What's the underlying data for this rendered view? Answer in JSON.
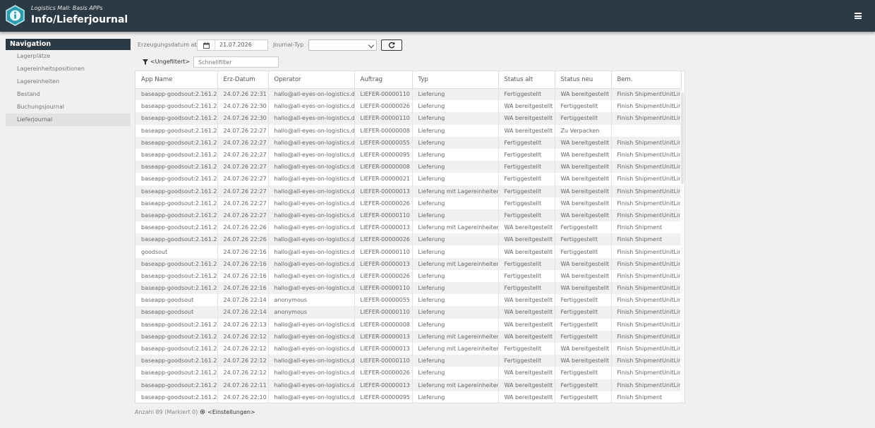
{
  "header": {
    "app_name": "Logistics Mall: Basis APPs",
    "page_title": "Info/Lieferjournal",
    "bg_color": "#2b3a45",
    "logo_color": "#2a9db0"
  },
  "nav": {
    "title": "Navigation",
    "items": [
      {
        "label": "Lagerplätze",
        "active": false
      },
      {
        "label": "Lagereinheitspositionen",
        "active": false
      },
      {
        "label": "Lagereinheiten",
        "active": false
      },
      {
        "label": "Bestand",
        "active": false
      },
      {
        "label": "Buchungsjournal",
        "active": false
      },
      {
        "label": "Lieferjournal",
        "active": true
      }
    ]
  },
  "filters": {
    "date_label": "Erzeugungsdatum ab",
    "date_value": "21.07.2026",
    "journal_type_label": "Journal-Typ",
    "journal_type_value": "",
    "unfiltered_label": "<Ungefiltert>",
    "quick_filter_placeholder": "Schnellfilter"
  },
  "table": {
    "columns": [
      "App Name",
      "Erz-Datum",
      "Operator",
      "Auftrag",
      "Typ",
      "Status alt",
      "Status neu",
      "Bem."
    ],
    "rows": [
      [
        "baseapp-goodsout:2.161.2",
        "24.07.26 22:31",
        "hallo@all-eyes-on-logistics.de",
        "LIEFER-00000110",
        "Lieferung",
        "Fertiggestellt",
        "WA bereitgestellt",
        "Finish ShipmentUnitLine"
      ],
      [
        "baseapp-goodsout:2.161.2",
        "24.07.26 22:30",
        "hallo@all-eyes-on-logistics.de",
        "LIEFER-00000026",
        "Lieferung",
        "WA bereitgestellt",
        "Fertiggestellt",
        "Finish ShipmentUnitLine"
      ],
      [
        "baseapp-goodsout:2.161.2",
        "24.07.26 22:30",
        "hallo@all-eyes-on-logistics.de",
        "LIEFER-00000110",
        "Lieferung",
        "WA bereitgestellt",
        "Fertiggestellt",
        "Finish ShipmentUnitLine"
      ],
      [
        "baseapp-goodsout:2.161.2",
        "24.07.26 22:27",
        "hallo@all-eyes-on-logistics.de",
        "LIEFER-00000008",
        "Lieferung",
        "WA bereitgestellt",
        "Zu Verpacken",
        ""
      ],
      [
        "baseapp-goodsout:2.161.2",
        "24.07.26 22:27",
        "hallo@all-eyes-on-logistics.de",
        "LIEFER-00000055",
        "Lieferung",
        "Fertiggestellt",
        "WA bereitgestellt",
        "Finish ShipmentUnitLine"
      ],
      [
        "baseapp-goodsout:2.161.2",
        "24.07.26 22:27",
        "hallo@all-eyes-on-logistics.de",
        "LIEFER-00000095",
        "Lieferung",
        "Fertiggestellt",
        "WA bereitgestellt",
        "Finish ShipmentUnitLine"
      ],
      [
        "baseapp-goodsout:2.161.2",
        "24.07.26 22:27",
        "hallo@all-eyes-on-logistics.de",
        "LIEFER-00000008",
        "Lieferung",
        "Fertiggestellt",
        "WA bereitgestellt",
        "Finish ShipmentUnitLine"
      ],
      [
        "baseapp-goodsout:2.161.2",
        "24.07.26 22:27",
        "hallo@all-eyes-on-logistics.de",
        "LIEFER-00000021",
        "Lieferung",
        "Fertiggestellt",
        "WA bereitgestellt",
        "Finish ShipmentUnitLine"
      ],
      [
        "baseapp-goodsout:2.161.2",
        "24.07.26 22:27",
        "hallo@all-eyes-on-logistics.de",
        "LIEFER-00000013",
        "Lieferung mit Lagereinheiten",
        "Fertiggestellt",
        "WA bereitgestellt",
        "Finish ShipmentUnitLine"
      ],
      [
        "baseapp-goodsout:2.161.2",
        "24.07.26 22:27",
        "hallo@all-eyes-on-logistics.de",
        "LIEFER-00000026",
        "Lieferung",
        "Fertiggestellt",
        "WA bereitgestellt",
        "Finish ShipmentUnitLine"
      ],
      [
        "baseapp-goodsout:2.161.2",
        "24.07.26 22:27",
        "hallo@all-eyes-on-logistics.de",
        "LIEFER-00000110",
        "Lieferung",
        "Fertiggestellt",
        "WA bereitgestellt",
        "Finish ShipmentUnitLine"
      ],
      [
        "baseapp-goodsout:2.161.2",
        "24.07.26 22:26",
        "hallo@all-eyes-on-logistics.de",
        "LIEFER-00000013",
        "Lieferung mit Lagereinheiten",
        "WA bereitgestellt",
        "Fertiggestellt",
        "Finish Shipment"
      ],
      [
        "baseapp-goodsout:2.161.2",
        "24.07.26 22:26",
        "hallo@all-eyes-on-logistics.de",
        "LIEFER-00000026",
        "Lieferung",
        "WA bereitgestellt",
        "Fertiggestellt",
        "Finish Shipment"
      ],
      [
        "goodsout",
        "24.07.26 22:16",
        "hallo@all-eyes-on-logistics.de",
        "LIEFER-00000110",
        "Lieferung",
        "WA bereitgestellt",
        "Fertiggestellt",
        "Finish ShipmentUnitLine"
      ],
      [
        "baseapp-goodsout:2.161.2",
        "24.07.26 22:16",
        "hallo@all-eyes-on-logistics.de",
        "LIEFER-00000013",
        "Lieferung mit Lagereinheiten",
        "Fertiggestellt",
        "WA bereitgestellt",
        "Finish ShipmentUnitLine"
      ],
      [
        "baseapp-goodsout:2.161.2",
        "24.07.26 22:16",
        "hallo@all-eyes-on-logistics.de",
        "LIEFER-00000026",
        "Lieferung",
        "Fertiggestellt",
        "WA bereitgestellt",
        "Finish ShipmentUnitLine"
      ],
      [
        "baseapp-goodsout:2.161.2",
        "24.07.26 22:16",
        "hallo@all-eyes-on-logistics.de",
        "LIEFER-00000110",
        "Lieferung",
        "Fertiggestellt",
        "WA bereitgestellt",
        "Finish ShipmentUnitLine"
      ],
      [
        "baseapp-goodsout",
        "24.07.26 22:14",
        "anonymous",
        "LIEFER-00000055",
        "Lieferung",
        "WA bereitgestellt",
        "Fertiggestellt",
        "Finish ShipmentUnitLine"
      ],
      [
        "baseapp-goodsout",
        "24.07.26 22:14",
        "anonymous",
        "LIEFER-00000110",
        "Lieferung",
        "WA bereitgestellt",
        "Fertiggestellt",
        "Finish ShipmentUnitLine"
      ],
      [
        "baseapp-goodsout:2.161.2",
        "24.07.26 22:13",
        "hallo@all-eyes-on-logistics.de",
        "LIEFER-00000008",
        "Lieferung",
        "WA bereitgestellt",
        "Fertiggestellt",
        "Finish ShipmentUnitLine"
      ],
      [
        "baseapp-goodsout:2.161.2",
        "24.07.26 22:12",
        "hallo@all-eyes-on-logistics.de",
        "LIEFER-00000013",
        "Lieferung mit Lagereinheiten",
        "WA bereitgestellt",
        "Fertiggestellt",
        "Finish ShipmentUnitLine"
      ],
      [
        "baseapp-goodsout:2.161.2",
        "24.07.26 22:12",
        "hallo@all-eyes-on-logistics.de",
        "LIEFER-00000013",
        "Lieferung mit Lagereinheiten",
        "Fertiggestellt",
        "WA bereitgestellt",
        "Finish ShipmentUnitLine"
      ],
      [
        "baseapp-goodsout:2.161.2",
        "24.07.26 22:12",
        "hallo@all-eyes-on-logistics.de",
        "LIEFER-00000110",
        "Lieferung",
        "Fertiggestellt",
        "WA bereitgestellt",
        "Finish ShipmentUnitLine"
      ],
      [
        "baseapp-goodsout:2.161.2",
        "24.07.26 22:12",
        "hallo@all-eyes-on-logistics.de",
        "LIEFER-00000026",
        "Lieferung",
        "WA bereitgestellt",
        "Fertiggestellt",
        "Finish ShipmentUnitLine"
      ],
      [
        "baseapp-goodsout:2.161.2",
        "24.07.26 22:11",
        "hallo@all-eyes-on-logistics.de",
        "LIEFER-00000013",
        "Lieferung mit Lagereinheiten",
        "WA bereitgestellt",
        "Fertiggestellt",
        "Finish ShipmentUnitLine"
      ],
      [
        "baseapp-goodsout:2.161.2",
        "24.07.26 22:10",
        "hallo@all-eyes-on-logistics.de",
        "LIEFER-00000095",
        "Lieferung",
        "WA bereitgestellt",
        "Fertiggestellt",
        "Finish Shipment"
      ]
    ]
  },
  "footer": {
    "count_text": "Anzahl 89 (Markiert 0)",
    "settings_label": "<Einstellungen>"
  },
  "icons": {
    "logo": "info-logo-icon",
    "menu": "hamburger-menu-icon",
    "calendar": "calendar-icon",
    "refresh": "refresh-icon",
    "filter": "filter-icon",
    "settings": "gear-icon"
  }
}
